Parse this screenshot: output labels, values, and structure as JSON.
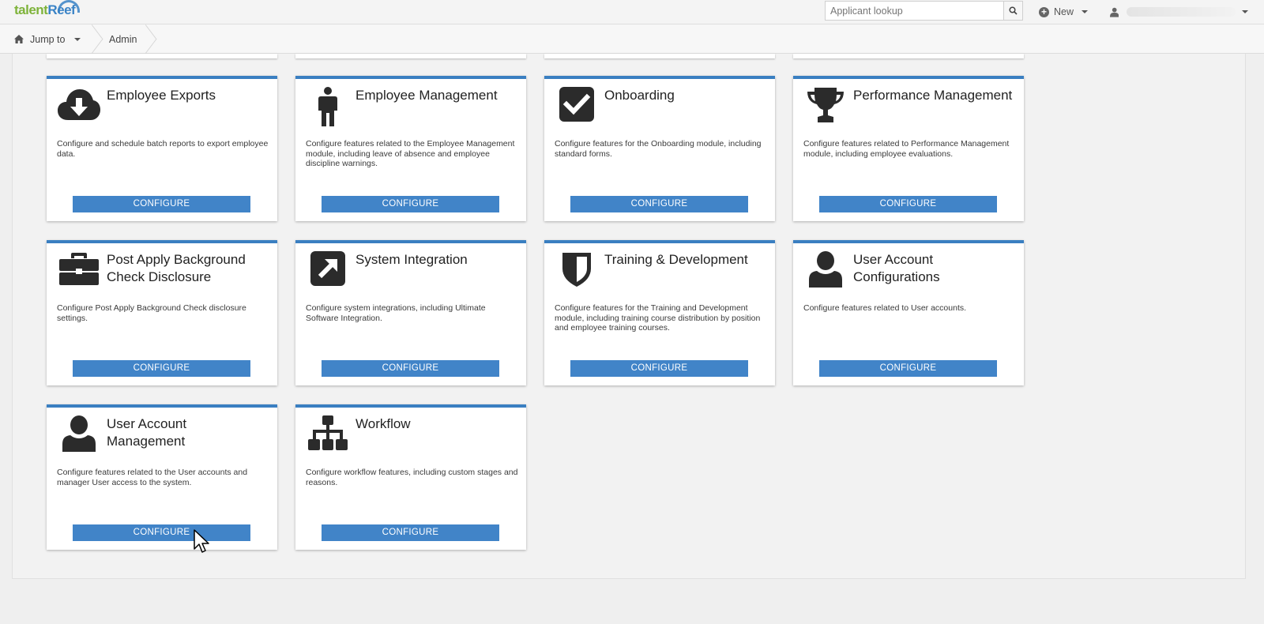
{
  "app": {
    "logo_part1": "talent",
    "logo_part2": "Reef"
  },
  "header": {
    "search_placeholder": "Applicant lookup",
    "new_label": "New",
    "user_name": ""
  },
  "breadcrumb": {
    "jump_label": "Jump to",
    "admin_label": "Admin"
  },
  "button_label": "CONFIGURE",
  "cards": [
    {
      "icon": "cloud-download-icon",
      "title": "Employee Exports",
      "description": "Configure and schedule batch reports to export employee data."
    },
    {
      "icon": "person-icon",
      "title": "Employee Management",
      "description": "Configure features related to the Employee Management module, including leave of absence and employee discipline warnings."
    },
    {
      "icon": "checkbox-icon",
      "title": "Onboarding",
      "description": "Configure features for the Onboarding module, including standard forms."
    },
    {
      "icon": "trophy-icon",
      "title": "Performance Management",
      "description": "Configure features related to Performance Management module, including employee evaluations."
    },
    {
      "icon": "briefcase-icon",
      "title": "Post Apply Background Check Disclosure",
      "description": "Configure Post Apply Background Check disclosure settings."
    },
    {
      "icon": "external-link-icon",
      "title": "System Integration",
      "description": "Configure system integrations, including Ultimate Software Integration."
    },
    {
      "icon": "shield-icon",
      "title": "Training & Development",
      "description": "Configure features for the Training and Development module, including training course distribution by position and employee training courses."
    },
    {
      "icon": "user-icon",
      "title": "User Account Configurations",
      "description": "Configure features related to User accounts."
    },
    {
      "icon": "user-icon",
      "title": "User Account Management",
      "description": "Configure features related to the User accounts and manager User access to the system."
    },
    {
      "icon": "sitemap-icon",
      "title": "Workflow",
      "description": "Configure workflow features, including custom stages and reasons."
    }
  ]
}
